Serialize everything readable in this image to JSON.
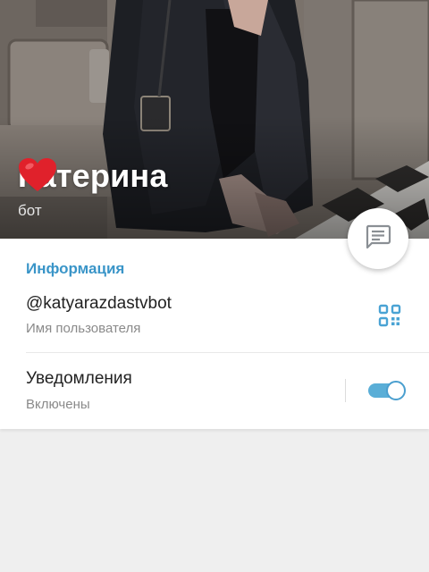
{
  "profile": {
    "name": "Катерина",
    "status": "бот"
  },
  "info": {
    "section_title": "Информация",
    "username": "@katyarazdastvbot",
    "username_label": "Имя пользователя",
    "notifications_title": "Уведомления",
    "notifications_status": "Включены",
    "notifications_enabled": true
  },
  "icons": {
    "heart": "red-heart-emoji",
    "message": "message-icon",
    "qr": "qr-code-icon"
  },
  "colors": {
    "accent": "#3a95c8",
    "toggle_on": "#5aaed7",
    "heart": "#e0212b"
  }
}
